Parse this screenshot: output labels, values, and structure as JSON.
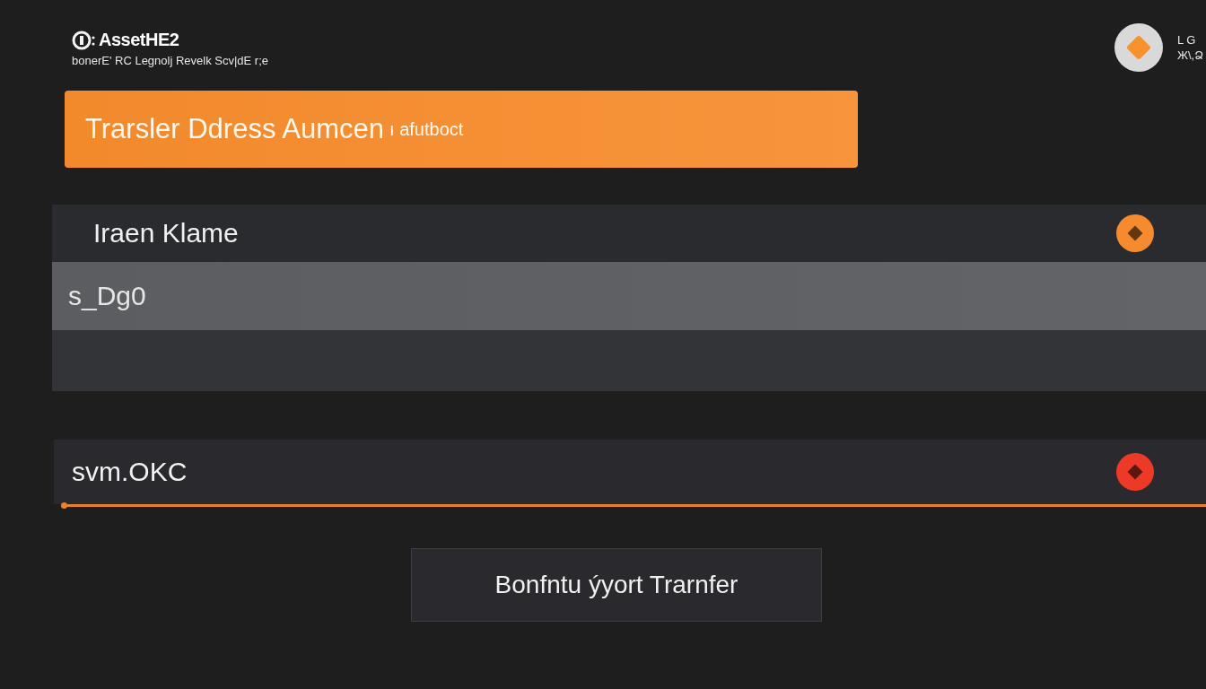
{
  "header": {
    "title": "AssetHE2",
    "subtitle": "bonerE' RC Legnolj Revelk Scv|dE r;e",
    "user": {
      "line_1": "L G",
      "line_2": "Ж\\,Ձ"
    }
  },
  "banner": {
    "title": "Trarsler Ddress Aumcen",
    "suffix": "ı afutboct"
  },
  "fields": [
    {
      "kind": "select",
      "label": "Iraen Klame",
      "color": "#f58a2e",
      "options": [
        {
          "label": "s_Dg0",
          "selected": true
        }
      ]
    },
    {
      "kind": "input",
      "value": "svm.OKC",
      "color": "#ec3a26",
      "focused": true
    }
  ],
  "button": {
    "label": "Bonfntu ýyort Trarnfer"
  }
}
